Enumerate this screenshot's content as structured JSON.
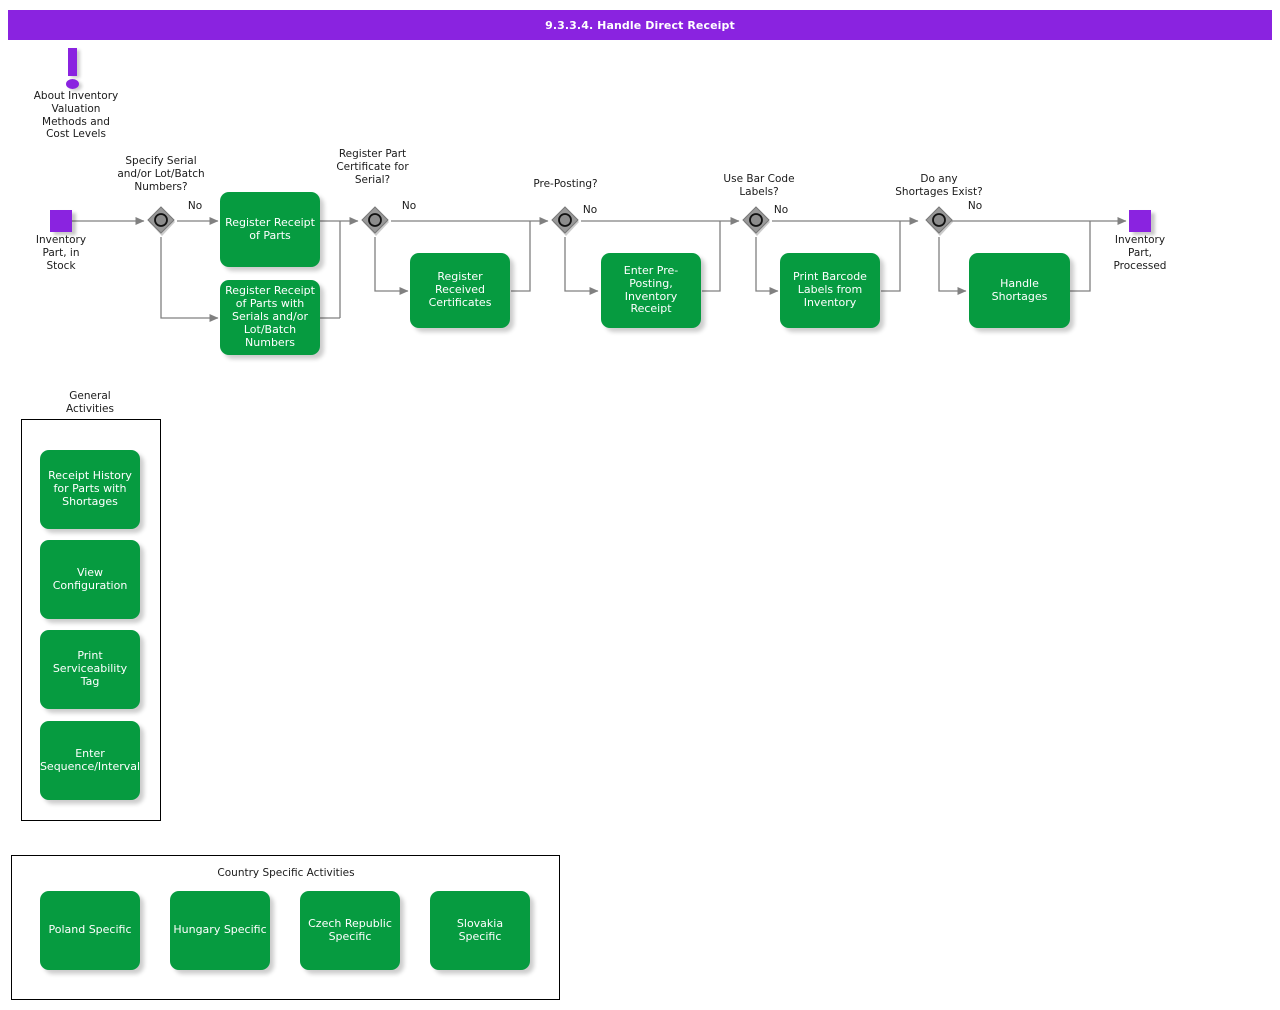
{
  "header": {
    "title": "9.3.3.4. Handle Direct Receipt"
  },
  "colors": {
    "accent_purple": "#8a23e0",
    "task_green": "#069b40",
    "gateway_gray": "#999999",
    "connector_gray": "#808080",
    "frame_black": "#000000",
    "text_dark": "#1a1a1a",
    "task_text": "#ffffff"
  },
  "note": {
    "icon": "exclamation-icon",
    "label": "About Inventory\nValuation\nMethods and\nCost Levels"
  },
  "flow": {
    "start": {
      "name": "start-event",
      "label": "Inventory\nPart, in\nStock"
    },
    "end": {
      "name": "end-event",
      "label": "Inventory\nPart,\nProcessed"
    },
    "gateways": [
      {
        "id": "g1",
        "question": "Specify Serial\nand/or Lot/Batch\nNumbers?",
        "branch_label": "No"
      },
      {
        "id": "g2",
        "question": "Register Part\nCertificate for\nSerial?",
        "branch_label": "No"
      },
      {
        "id": "g3",
        "question": "Pre-Posting?",
        "branch_label": "No"
      },
      {
        "id": "g4",
        "question": "Use Bar Code\nLabels?",
        "branch_label": "No"
      },
      {
        "id": "g5",
        "question": "Do any\nShortages Exist?",
        "branch_label": "No"
      }
    ],
    "tasks": [
      {
        "id": "t1",
        "label": "Register Receipt\nof Parts"
      },
      {
        "id": "t2",
        "label": "Register Receipt\nof Parts with\nSerials and/or\nLot/Batch\nNumbers"
      },
      {
        "id": "t3",
        "label": "Register\nReceived\nCertificates"
      },
      {
        "id": "t4",
        "label": "Enter Pre-\nPosting,\nInventory\nReceipt"
      },
      {
        "id": "t5",
        "label": "Print Barcode\nLabels from\nInventory"
      },
      {
        "id": "t6",
        "label": "Handle\nShortages"
      }
    ]
  },
  "general_activities": {
    "title": "General\nActivities",
    "items": [
      {
        "label": "Receipt History\nfor Parts with\nShortages"
      },
      {
        "label": "View\nConfiguration"
      },
      {
        "label": "Print\nServiceability\nTag"
      },
      {
        "label": "Enter\nSequence/Interval"
      }
    ]
  },
  "country_specific_activities": {
    "title": "Country Specific Activities",
    "items": [
      {
        "label": "Poland Specific"
      },
      {
        "label": "Hungary Specific"
      },
      {
        "label": "Czech Republic\nSpecific"
      },
      {
        "label": "Slovakia\nSpecific"
      }
    ]
  }
}
